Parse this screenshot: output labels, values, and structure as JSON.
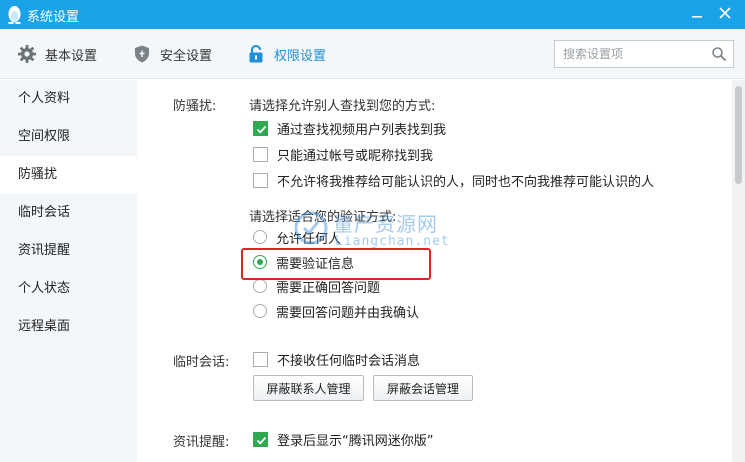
{
  "window": {
    "title": "系统设置"
  },
  "tabs": [
    {
      "label": "基本设置",
      "icon": "gear-icon"
    },
    {
      "label": "安全设置",
      "icon": "shield-icon"
    },
    {
      "label": "权限设置",
      "icon": "lock-icon",
      "active": true
    }
  ],
  "search": {
    "placeholder": "搜索设置项",
    "value": ""
  },
  "sidebar": {
    "items": [
      {
        "label": "个人资料"
      },
      {
        "label": "空间权限"
      },
      {
        "label": "防骚扰",
        "active": true
      },
      {
        "label": "临时会话"
      },
      {
        "label": "资讯提醒"
      },
      {
        "label": "个人状态"
      },
      {
        "label": "远程桌面"
      }
    ]
  },
  "anti_harassment": {
    "label": "防骚扰:",
    "find_prompt": "请选择允许别人查找到您的方式:",
    "find_options": [
      {
        "label": "通过查找视频用户列表找到我",
        "checked": true
      },
      {
        "label": "只能通过帐号或昵称找到我",
        "checked": false
      },
      {
        "label": "不允许将我推荐给可能认识的人，同时也不向我推荐可能认识的人",
        "checked": false
      }
    ],
    "verify_prompt": "请选择适合您的验证方式:",
    "verify_options": [
      {
        "label": "允许任何人",
        "selected": false
      },
      {
        "label": "需要验证信息",
        "selected": true
      },
      {
        "label": "需要正确回答问题",
        "selected": false
      },
      {
        "label": "需要回答问题并由我确认",
        "selected": false
      }
    ]
  },
  "temp_session": {
    "label": "临时会话:",
    "option": {
      "label": "不接收任何临时会话消息",
      "checked": false
    },
    "buttons": {
      "contacts": "屏蔽联系人管理",
      "sessions": "屏蔽会话管理"
    }
  },
  "news_reminder": {
    "label": "资讯提醒:",
    "option": {
      "label": "登录后显示“腾讯网迷你版”",
      "checked": true
    }
  },
  "watermark": {
    "cn": "量产资源网",
    "en": "Liangchan.net"
  },
  "colors": {
    "titlebar": "#1aa3e8",
    "accent": "#1f8fd6",
    "check_green": "#2fa84f",
    "highlight_red": "#e02424"
  }
}
